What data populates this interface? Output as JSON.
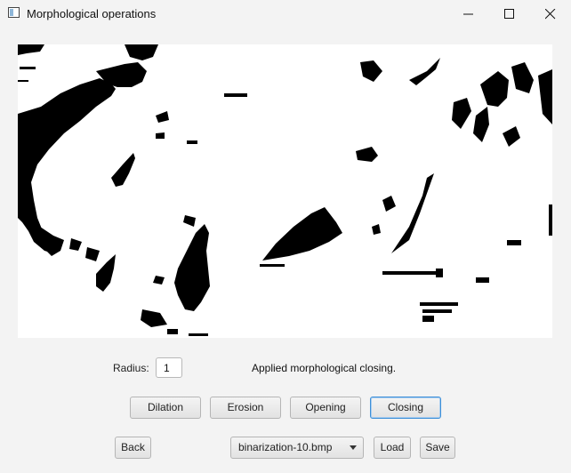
{
  "window": {
    "title": "Morphological operations",
    "app_icon": "window-app-icon",
    "controls": [
      "minimize-icon",
      "maximize-icon",
      "close-icon"
    ]
  },
  "radius": {
    "label": "Radius:",
    "value": "1"
  },
  "status": "Applied morphological closing.",
  "operations": {
    "dilation": "Dilation",
    "erosion": "Erosion",
    "opening": "Opening",
    "closing": "Closing"
  },
  "bottom": {
    "back": "Back",
    "file_select": "binarization-10.bmp",
    "load": "Load",
    "save": "Save"
  }
}
